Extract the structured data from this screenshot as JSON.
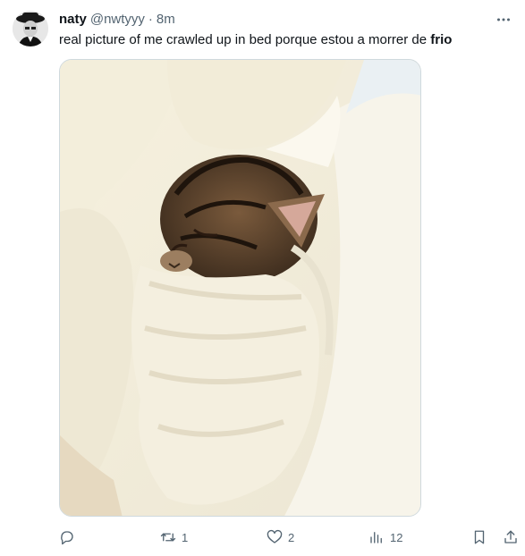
{
  "author": {
    "display_name": "naty",
    "handle": "@nwtyyy",
    "separator": "·",
    "time": "8m"
  },
  "tweet": {
    "text_plain": "real picture of me crawled up in bed porque estou a morrer de ",
    "text_bold": "frio"
  },
  "actions": {
    "reply_count": "",
    "retweet_count": "1",
    "like_count": "2",
    "views_count": "12"
  },
  "icons": {
    "more": "more-horizontal-icon",
    "reply": "reply-icon",
    "retweet": "retweet-icon",
    "like": "heart-icon",
    "views": "analytics-icon",
    "bookmark": "bookmark-icon",
    "share": "share-icon"
  },
  "colors": {
    "text_primary": "#0f1419",
    "text_secondary": "#536471",
    "border": "#cfd9de"
  }
}
